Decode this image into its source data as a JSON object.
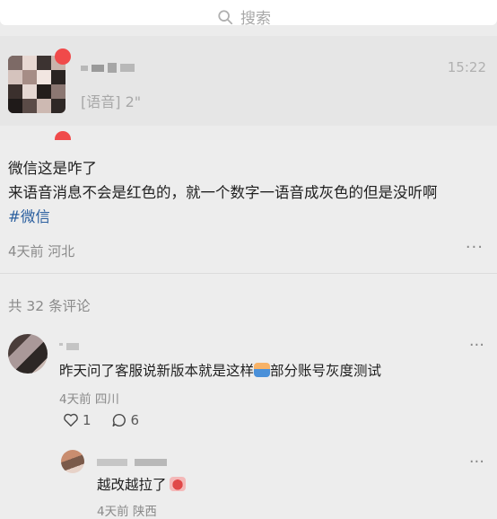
{
  "search": {
    "label": "搜索"
  },
  "chat_preview": {
    "time": "15:22",
    "last_message": "[语音] 2\""
  },
  "post": {
    "line1": "微信这是咋了",
    "line2": "来语音消息不会是红色的，就一个数字一语音成灰色的但是没听啊",
    "hashtag": "#微信",
    "meta": "4天前 河北",
    "more_label": "···"
  },
  "comments": {
    "count_label": "共 32 条评论",
    "items": [
      {
        "text_before": "昨天问了客服说新版本就是这样",
        "text_after": "部分账号灰度测试",
        "meta": "4天前 四川",
        "likes": "1",
        "replies": "6",
        "more_label": "···",
        "reply": {
          "text": "越改越拉了",
          "meta": "4天前 陕西",
          "more_label": "···"
        }
      }
    ]
  },
  "colors": {
    "background": "#ededed",
    "hashtag": "#2b5f9f",
    "badge_red": "#f04a4a"
  }
}
